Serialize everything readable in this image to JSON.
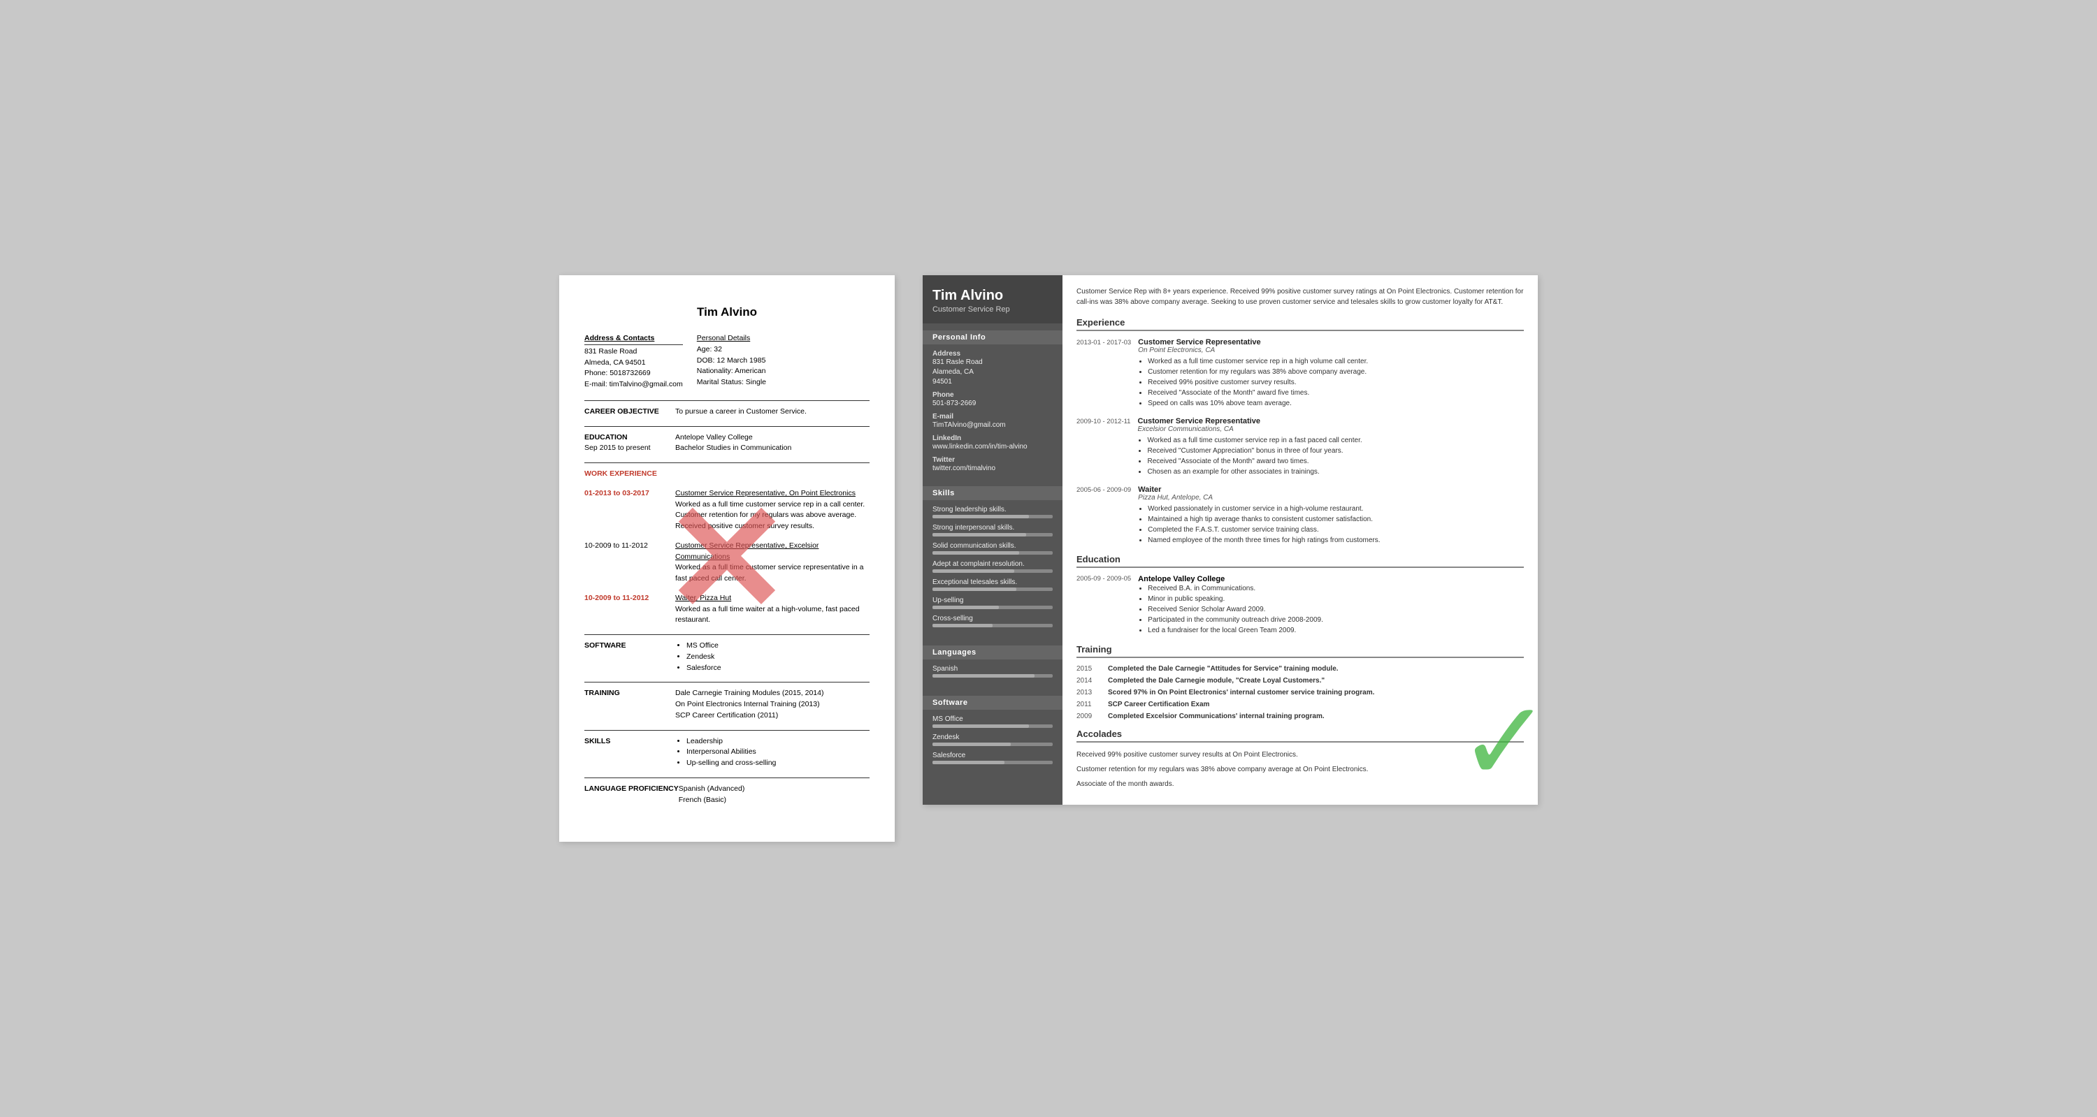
{
  "left_resume": {
    "title": "Tim Alvino",
    "address_header": "Address & Contacts",
    "address_lines": [
      "831 Rasle Road",
      "Almeda, CA 94501",
      "Phone: 5018732669",
      "E-mail: timTalvino@gmail.com"
    ],
    "personal_header": "Personal Details",
    "personal_lines": [
      "Age:  32",
      "DOB:  12 March 1985",
      "Nationality: American",
      "Marital Status: Single"
    ],
    "career_label": "CAREER OBJECTIVE",
    "career_text": "To pursue a career in Customer Service.",
    "education_label": "EDUCATION",
    "education_date": "Sep 2015 to present",
    "education_place": "Antelope Valley College",
    "education_degree": "Bachelor Studies in Communication",
    "work_label": "WORK EXPERIENCE",
    "work_items": [
      {
        "date": "01-2013 to 03-2017",
        "title": "Customer Service Representative, On Point Electronics",
        "description": "Worked as a full time customer service rep in a call center. Customer retention for my regulars was above average. Received positive customer survey results."
      },
      {
        "date": "10-2009 to 11-2012",
        "title": "Customer Service Representative, Excelsior Communications",
        "description": "Worked as a full time customer service representative in a fast paced call center."
      },
      {
        "date": "10-2009 to 11-2012",
        "title": "Waiter, Pizza Hut",
        "description": "Worked as a full time waiter at a high-volume, fast paced restaurant."
      }
    ],
    "software_label": "SOFTWARE",
    "software_items": [
      "MS Office",
      "Zendesk",
      "Salesforce"
    ],
    "training_label": "TRAINING",
    "training_items": [
      "Dale Carnegie Training Modules (2015, 2014)",
      "On Point Electronics Internal Training (2013)",
      "SCP Career Certification (2011)"
    ],
    "skills_label": "SKILLS",
    "skills_items": [
      "Leadership",
      "Interpersonal Abilities",
      "Up-selling and cross-selling"
    ],
    "language_label": "LANGUAGE PROFICIENCY",
    "language_items": [
      "Spanish (Advanced)",
      "French (Basic)"
    ]
  },
  "right_resume": {
    "name": "Tim Alvino",
    "job_title": "Customer Service Rep",
    "summary": "Customer Service Rep with 8+ years experience. Received 99% positive customer survey ratings at On Point Electronics. Customer retention for call-ins was 38% above company average. Seeking to use proven customer service and telesales skills to grow customer loyalty for AT&T.",
    "sidebar": {
      "personal_info_header": "Personal Info",
      "address_label": "Address",
      "address_lines": [
        "831 Rasle Road",
        "Alameda, CA",
        "94501"
      ],
      "phone_label": "Phone",
      "phone_value": "501-873-2669",
      "email_label": "E-mail",
      "email_value": "TimTAlvino@gmail.com",
      "linkedin_label": "LinkedIn",
      "linkedin_value": "www.linkedin.com/in/tim-alvino",
      "twitter_label": "Twitter",
      "twitter_value": "twitter.com/timalvino",
      "skills_header": "Skills",
      "skills": [
        {
          "label": "Strong leadership skills.",
          "pct": 80
        },
        {
          "label": "Strong interpersonal skills.",
          "pct": 78
        },
        {
          "label": "Solid communication skills.",
          "pct": 72
        },
        {
          "label": "Adept at complaint resolution.",
          "pct": 68
        },
        {
          "label": "Exceptional telesales skills.",
          "pct": 70
        },
        {
          "label": "Up-selling",
          "pct": 55
        },
        {
          "label": "Cross-selling",
          "pct": 50
        }
      ],
      "languages_header": "Languages",
      "languages": [
        {
          "label": "Spanish",
          "pct": 85
        }
      ],
      "software_header": "Software",
      "software": [
        {
          "label": "MS Office",
          "pct": 80
        },
        {
          "label": "Zendesk",
          "pct": 65
        },
        {
          "label": "Salesforce",
          "pct": 60
        }
      ]
    },
    "experience_header": "Experience",
    "experience": [
      {
        "date": "2013-01 - 2017-03",
        "title": "Customer Service Representative",
        "company": "On Point Electronics, CA",
        "bullets": [
          "Worked as a full time customer service rep in a high volume call center.",
          "Customer retention for my regulars was 38% above company average.",
          "Received 99% positive customer survey results.",
          "Received \"Associate of the Month\" award five times.",
          "Speed on calls was 10% above team average."
        ]
      },
      {
        "date": "2009-10 - 2012-11",
        "title": "Customer Service Representative",
        "company": "Excelsior Communications, CA",
        "bullets": [
          "Worked as a full time customer service rep in a fast paced call center.",
          "Received \"Customer Appreciation\" bonus in three of four years.",
          "Received \"Associate of the Month\" award two times.",
          "Chosen as an example for other associates in trainings."
        ]
      },
      {
        "date": "2005-06 - 2009-09",
        "title": "Waiter",
        "company": "Pizza Hut, Antelope, CA",
        "bullets": [
          "Worked passionately in customer service in a high-volume restaurant.",
          "Maintained a high tip average thanks to consistent customer satisfaction.",
          "Completed the F.A.S.T. customer service training class.",
          "Named employee of the month three times for high ratings from customers."
        ]
      }
    ],
    "education_header": "Education",
    "education": [
      {
        "date": "2005-09 - 2009-05",
        "school": "Antelope Valley College",
        "bullets": [
          "Received B.A. in Communications.",
          "Minor in public speaking.",
          "Received Senior Scholar Award 2009.",
          "Participated in the community outreach drive 2008-2009.",
          "Led a fundraiser for the local Green Team 2009."
        ]
      }
    ],
    "training_header": "Training",
    "training": [
      {
        "year": "2015",
        "desc": "Completed the Dale Carnegie \"Attitudes for Service\" training module."
      },
      {
        "year": "2014",
        "desc": "Completed the Dale Carnegie module, \"Create Loyal Customers.\""
      },
      {
        "year": "2013",
        "desc": "Scored 97% in On Point Electronics' internal customer service training program."
      },
      {
        "year": "2011",
        "desc": "SCP Career Certification Exam"
      },
      {
        "year": "2009",
        "desc": "Completed Excelsior Communications' internal training program."
      }
    ],
    "accolades_header": "Accolades",
    "accolades": [
      "Received 99% positive customer survey results at On Point Electronics.",
      "Customer retention for my regulars was 38% above company average at On Point Electronics.",
      "Associate of the month awards."
    ]
  }
}
